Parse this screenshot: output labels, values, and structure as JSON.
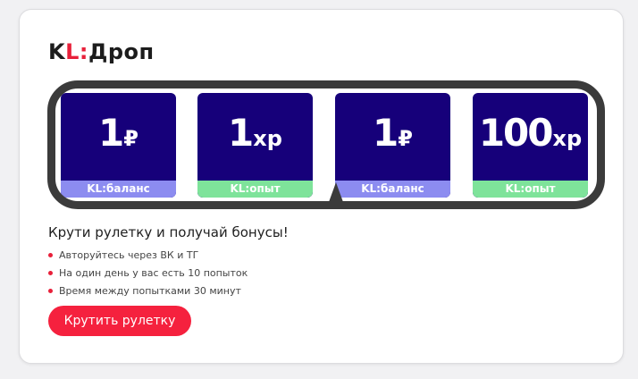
{
  "logo": {
    "part1": "K",
    "part2": "L:",
    "part3": "Дроп"
  },
  "roulette": {
    "prizes": [
      {
        "number": "1",
        "unit": "₽",
        "label": "KL:баланс",
        "label_color": "#8c8cf0"
      },
      {
        "number": "1",
        "unit": "xp",
        "label": "KL:опыт",
        "label_color": "#7ee39a"
      },
      {
        "number": "1",
        "unit": "₽",
        "label": "KL:баланс",
        "label_color": "#8c8cf0"
      },
      {
        "number": "100",
        "unit": "xp",
        "label": "KL:опыт",
        "label_color": "#7ee39a"
      }
    ]
  },
  "info": {
    "heading": "Крути рулетку и получай бонусы!",
    "rules": [
      "Авторуйтесь через ВК и ТГ",
      "На один день у вас есть 10 попыток",
      "Время между попытками 30 минут"
    ]
  },
  "actions": {
    "spin_label": "Крутить рулетку"
  },
  "colors": {
    "accent": "#f5213e",
    "prize_bg": "#16007a",
    "frame": "#3b3b3b"
  }
}
